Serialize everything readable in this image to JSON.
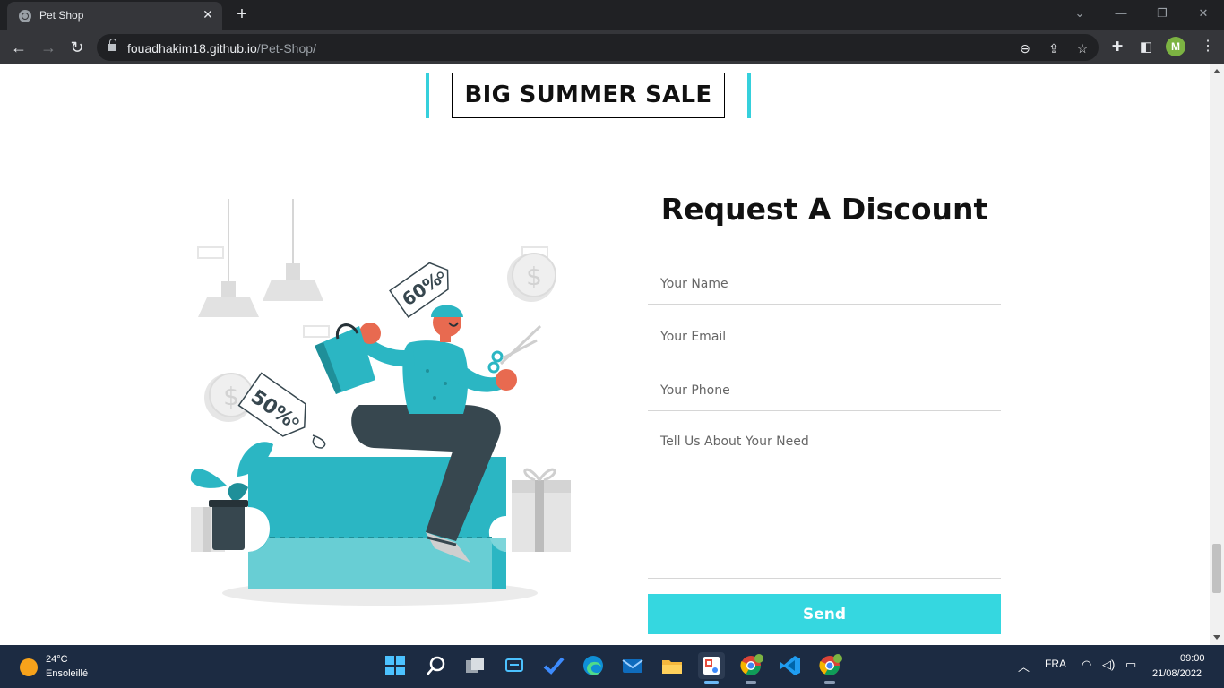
{
  "browser": {
    "tab_title": "Pet Shop",
    "url_host": "fouadhakim18.github.io",
    "url_path": "/Pet-Shop/",
    "profile_initial": "M"
  },
  "page": {
    "sale_banner": "BIG SUMMER SALE",
    "illustration": {
      "tag_left": "50%",
      "tag_right": "60%",
      "accent_color": "#2bb6c3"
    },
    "form": {
      "title": "Request A Discount",
      "name_placeholder": "Your Name",
      "email_placeholder": "Your Email",
      "phone_placeholder": "Your Phone",
      "need_placeholder": "Tell Us About Your Need",
      "send_label": "Send",
      "button_color": "#35d7e0"
    }
  },
  "taskbar": {
    "weather_temp": "24°C",
    "weather_condition": "Ensoleillé",
    "language": "FRA",
    "time": "09:00",
    "date": "21/08/2022",
    "apps": [
      "start",
      "search",
      "task-view",
      "widgets",
      "todo",
      "edge",
      "mail",
      "file-explorer",
      "snipping-tool",
      "chrome",
      "vscode",
      "chrome"
    ]
  }
}
